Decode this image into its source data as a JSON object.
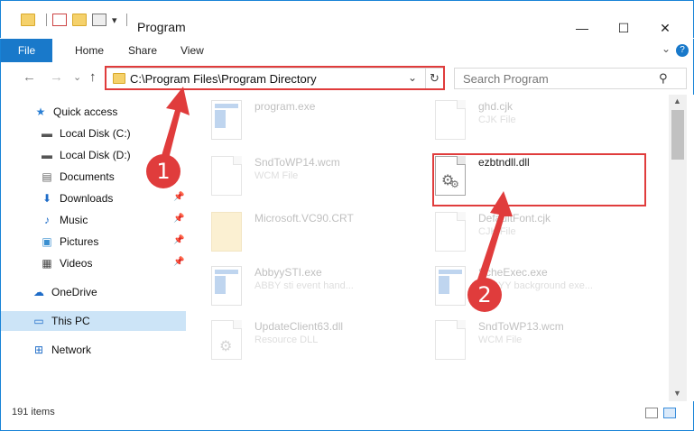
{
  "window": {
    "title": "Program",
    "minimize_glyph": "—",
    "maximize_glyph": "☐",
    "close_glyph": "✕"
  },
  "quick_access_toolbar": {
    "dropdown_glyph": "▾"
  },
  "ribbon": {
    "tabs": [
      "File",
      "Home",
      "Share",
      "View"
    ],
    "expand_glyph": "⌄",
    "help_glyph": "?"
  },
  "navigation": {
    "back_glyph": "←",
    "forward_glyph": "→",
    "recent_glyph": "⌄",
    "up_glyph": "↑",
    "address": "C:\\Program Files\\Program Directory",
    "address_dropdown_glyph": "⌄",
    "refresh_glyph": "↻",
    "search_placeholder": "Search Program",
    "search_glyph": "⚲"
  },
  "sidebar": {
    "items": [
      {
        "label": "Quick access",
        "icon": "star-icon",
        "glyph": "★"
      },
      {
        "label": "Local Disk (C:)",
        "icon": "drive-icon",
        "glyph": "▬"
      },
      {
        "label": "Local Disk (D:)",
        "icon": "drive-icon",
        "glyph": "▬"
      },
      {
        "label": "Documents",
        "icon": "document-icon",
        "glyph": "▤"
      },
      {
        "label": "Downloads",
        "icon": "download-icon",
        "glyph": "⬇"
      },
      {
        "label": "Music",
        "icon": "music-icon",
        "glyph": "♪"
      },
      {
        "label": "Pictures",
        "icon": "pictures-icon",
        "glyph": "▣"
      },
      {
        "label": "Videos",
        "icon": "video-icon",
        "glyph": "▦"
      },
      {
        "label": "OneDrive",
        "icon": "cloud-icon",
        "glyph": "☁"
      },
      {
        "label": "This PC",
        "icon": "computer-icon",
        "glyph": "▭"
      },
      {
        "label": "Network",
        "icon": "network-icon",
        "glyph": "⊞"
      }
    ],
    "pin_glyph": "📌"
  },
  "files": [
    {
      "name": "program.exe",
      "type": ""
    },
    {
      "name": "ghd.cjk",
      "type": "CJK File"
    },
    {
      "name": "SndToWP14.wcm",
      "type": "WCM File"
    },
    {
      "name": "ezbtndll.dll",
      "type": ""
    },
    {
      "name": "Microsoft.VC90.CRT",
      "type": ""
    },
    {
      "name": "DefaultFont.cjk",
      "type": "CJK File"
    },
    {
      "name": "AbbyySTI.exe",
      "type": "ABBY sti event hand..."
    },
    {
      "name": "ScheExec.exe",
      "type": "ABBYY background exe..."
    },
    {
      "name": "UpdateClient63.dll",
      "type": "Resource DLL"
    },
    {
      "name": "SndToWP13.wcm",
      "type": "WCM File"
    }
  ],
  "annotations": {
    "step1": "1",
    "step2": "2"
  },
  "status": {
    "item_count": "191 items"
  },
  "colors": {
    "accent": "#1979ca",
    "highlight_red": "#e03c3c",
    "selection": "#cce4f7"
  }
}
